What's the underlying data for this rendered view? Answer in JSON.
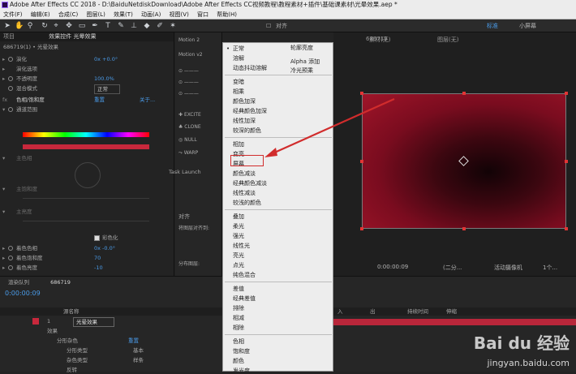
{
  "window": {
    "title": "Adobe After Effects CC 2018 - D:\\BaiduNetdiskDownload\\Adobe After Effects CC视频教程\\教程素材+插件\\基础课素材\\光晕效果.aep *"
  },
  "menubar": [
    "文件(F)",
    "编辑(E)",
    "合成(C)",
    "图层(L)",
    "效果(T)",
    "动画(A)",
    "视图(V)",
    "窗口",
    "帮助(H)"
  ],
  "toolbar": {
    "align_label": "对齐",
    "workspace_standard": "标准",
    "workspace_small": "小屏幕"
  },
  "left_panel": {
    "tabs": [
      "项目",
      "效果控件 光晕效果"
    ],
    "layer_path": "686719(1) • 光晕效果",
    "properties": [
      {
        "name": "演化",
        "value": "0x +0.0°"
      },
      {
        "name": "演化选项",
        "value": ""
      },
      {
        "name": "不透明度",
        "value": "100.0%"
      },
      {
        "name": "混合模式",
        "value": "正常"
      },
      {
        "name": "色相/饱和度",
        "value": "重置"
      },
      {
        "name": "通道范围",
        "value": ""
      },
      {
        "name": "主色相",
        "value": ""
      },
      {
        "name": "主饱和度",
        "value": ""
      },
      {
        "name": "主亮度",
        "value": ""
      },
      {
        "name": "彩色化",
        "value": ""
      },
      {
        "name": "着色色相",
        "value": "0x -0.0°"
      },
      {
        "name": "着色饱和度",
        "value": "70"
      },
      {
        "name": "着色亮度",
        "value": "-10"
      }
    ],
    "colorize_label": "彩色化",
    "reset_text": "重置",
    "about_text": "关于..."
  },
  "mid_panel": {
    "title": "Motion 2",
    "subtitle": "Motion v2",
    "buttons": [
      "EXCITE",
      "CLONE",
      "NULL",
      "WARP"
    ],
    "task_launch": "Task Launch",
    "align_title": "对齐",
    "align_to": "将图层对齐到:",
    "align_dist": "分布图层:"
  },
  "blend_menu": {
    "current": "正常",
    "groups": [
      [
        "正常",
        "溶解",
        "动态抖动溶解"
      ],
      [
        "变暗",
        "相乘",
        "颜色加深",
        "经典颜色加深",
        "线性加深",
        "较深的颜色"
      ],
      [
        "相加",
        "变亮",
        "屏幕",
        "颜色减淡",
        "经典颜色减淡",
        "线性减淡",
        "较浅的颜色"
      ],
      [
        "叠加",
        "柔光",
        "强光",
        "线性光",
        "亮光",
        "点光",
        "纯色混合"
      ],
      [
        "差值",
        "经典差值",
        "排除",
        "相减",
        "相除"
      ],
      [
        "色相",
        "饱和度",
        "颜色",
        "发光度"
      ]
    ],
    "submenu": [
      "轮廓亮度",
      "Alpha 添加",
      "冷光预乘"
    ],
    "highlighted": "屏幕"
  },
  "viewer": {
    "material_tab": "素材(无)",
    "layer_tab": "图层(无)",
    "comp_name": "686719",
    "timecode": "0:00:00:09",
    "resolution": "(二分...",
    "camera": "活动摄像机",
    "views": "1个..."
  },
  "timeline": {
    "tab_render": "渲染队列",
    "tab_comp": "686719",
    "timecode": "0:00:00:09",
    "col_source": "源名称",
    "col_in": "入",
    "col_out": "出",
    "col_duration": "持续时间",
    "col_stretch": "伸缩",
    "layer_num": "1",
    "layer_name": "光晕效果",
    "rows": [
      {
        "name": "效果",
        "value": ""
      },
      {
        "name": "分形杂色",
        "value": "重置"
      },
      {
        "name": "分形类型",
        "value": "基本"
      },
      {
        "name": "杂色类型",
        "value": "样条"
      },
      {
        "name": "反转",
        "value": ""
      }
    ]
  },
  "watermark": {
    "main": "Bai du 经验",
    "sub": "jingyan.baidu.com"
  },
  "colors": {
    "accent": "#4a9be8",
    "highlight_box": "#d12c2c",
    "arrow": "#d12c2c",
    "comp_red": "#a01529"
  }
}
